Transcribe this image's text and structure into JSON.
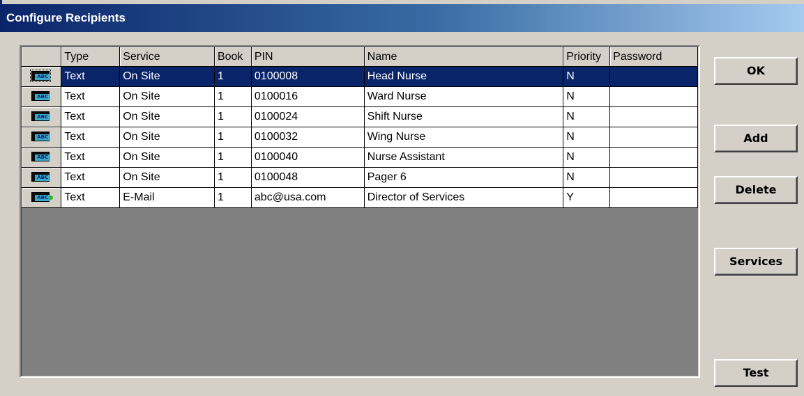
{
  "window": {
    "title": "Configure Recipients"
  },
  "grid": {
    "columns": [
      "Type",
      "Service",
      "Book",
      "PIN",
      "Name",
      "Priority",
      "Password"
    ],
    "rows": [
      {
        "icon": "pager-icon",
        "type": "Text",
        "service": "On Site",
        "book": "1",
        "pin": "0100008",
        "name": "Head Nurse",
        "priority": "N",
        "password": ""
      },
      {
        "icon": "pager-icon",
        "type": "Text",
        "service": "On Site",
        "book": "1",
        "pin": "0100016",
        "name": "Ward Nurse",
        "priority": "N",
        "password": ""
      },
      {
        "icon": "pager-icon",
        "type": "Text",
        "service": "On Site",
        "book": "1",
        "pin": "0100024",
        "name": "Shift Nurse",
        "priority": "N",
        "password": ""
      },
      {
        "icon": "pager-icon",
        "type": "Text",
        "service": "On Site",
        "book": "1",
        "pin": "0100032",
        "name": "Wing Nurse",
        "priority": "N",
        "password": ""
      },
      {
        "icon": "pager-icon",
        "type": "Text",
        "service": "On Site",
        "book": "1",
        "pin": "0100040",
        "name": "Nurse Assistant",
        "priority": "N",
        "password": ""
      },
      {
        "icon": "pager-icon",
        "type": "Text",
        "service": "On Site",
        "book": "1",
        "pin": "0100048",
        "name": "Pager 6",
        "priority": "N",
        "password": ""
      },
      {
        "icon": "email-pager-icon",
        "type": "Text",
        "service": "E-Mail",
        "book": "1",
        "pin": "abc@usa.com",
        "name": "Director of Services",
        "priority": "Y",
        "password": ""
      }
    ],
    "selected_row": 0,
    "icon_text": "ABC"
  },
  "buttons": {
    "ok": "OK",
    "add": "Add",
    "delete": "Delete",
    "services": "Services",
    "test": "Test"
  },
  "colors": {
    "selection": "#0a246a",
    "grid_background": "#808080",
    "face": "#d4d0c8"
  }
}
